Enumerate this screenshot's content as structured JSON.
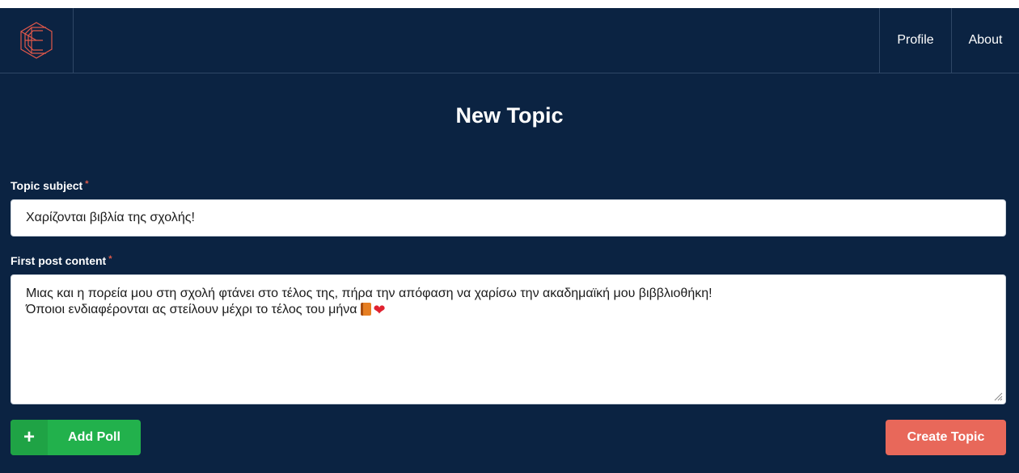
{
  "nav": {
    "logo_icon": "hexagon-c-logo-icon",
    "items": [
      {
        "label": "Profile"
      },
      {
        "label": "About"
      }
    ]
  },
  "page": {
    "title": "New Topic"
  },
  "form": {
    "subject": {
      "label": "Topic subject",
      "required_mark": "*",
      "value": "Χαρίζονται βιβλία της σχολής!"
    },
    "content": {
      "label": "First post content",
      "required_mark": "*",
      "lines": [
        "Μιας και η πορεία μου στη σχολή φτάνει στο τέλος της, πήρα την απόφαση να χαρίσω την ακαδημαϊκή μου βιββλιοθήκη!",
        "Όποιοι ενδιαφέρονται ας  στείλουν μέχρι το τέλος του μήνα"
      ],
      "emojis": [
        "book-emoji",
        "heart-emoji"
      ]
    }
  },
  "actions": {
    "add_poll": {
      "icon": "+",
      "label": "Add Poll"
    },
    "create": {
      "label": "Create Topic"
    }
  },
  "colors": {
    "background": "#0b2342",
    "add_poll": "#22b14c",
    "create": "#e8685a",
    "required": "#e05a4a"
  }
}
